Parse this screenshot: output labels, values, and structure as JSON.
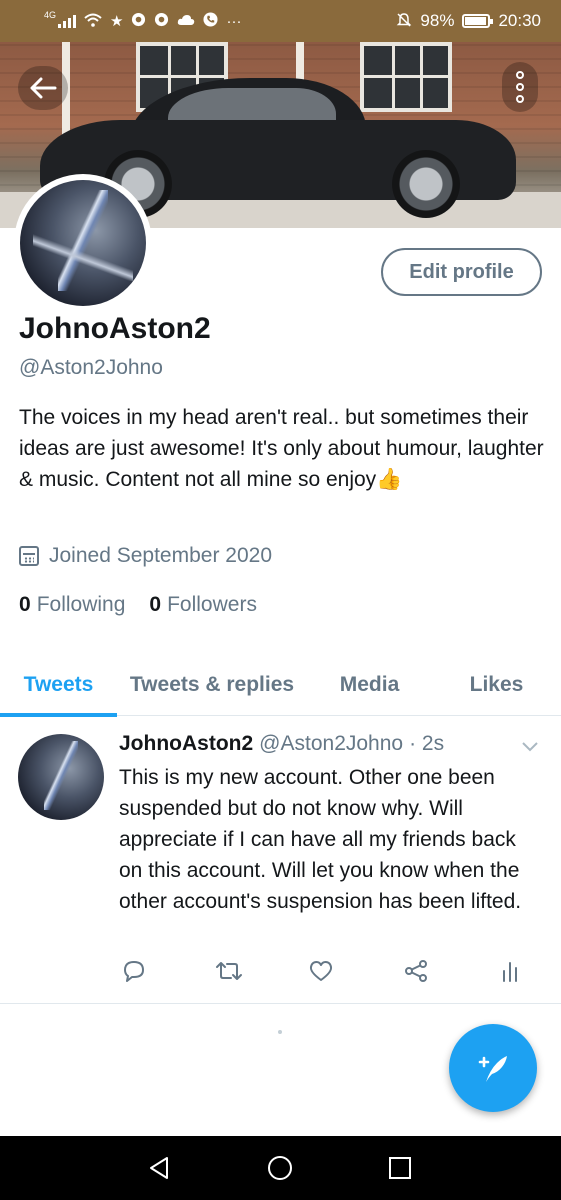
{
  "status_bar": {
    "network": "4G",
    "battery_percent": "98%",
    "time": "20:30",
    "more": "···",
    "icons": [
      "signal-icon",
      "wifi-icon",
      "star-icon",
      "chrome-icon",
      "chrome-icon",
      "cloud-icon",
      "phone-icon",
      "mute-bell-icon",
      "battery-icon"
    ]
  },
  "header": {
    "back_icon": "arrow-left-icon",
    "more_icon": "vertical-dots-icon"
  },
  "profile": {
    "name": "JohnoAston2",
    "handle": "@Aston2Johno",
    "bio": "The voices in my head aren't real.. but sometimes their ideas are just awesome! It's only about humour, laughter & music. Content not all mine so enjoy👍",
    "joined": "Joined September 2020",
    "edit_profile_label": "Edit profile",
    "following_count": "0",
    "following_label": "Following",
    "followers_count": "0",
    "followers_label": "Followers"
  },
  "tabs": [
    {
      "label": "Tweets",
      "active": true
    },
    {
      "label": "Tweets & replies",
      "active": false
    },
    {
      "label": "Media",
      "active": false
    },
    {
      "label": "Likes",
      "active": false
    }
  ],
  "tweet": {
    "author_name": "JohnoAston2",
    "author_handle": "@Aston2Johno",
    "time": "· 2s",
    "text": "This is my new account. Other one been suspended but do not know why. Will appreciate if I can have all my friends back on this account. Will let you know when the other account's suspension has been lifted.",
    "actions": [
      "reply-icon",
      "retweet-icon",
      "like-icon",
      "share-icon",
      "analytics-icon"
    ]
  },
  "fab": {
    "icon": "compose-tweet-icon"
  },
  "nav": {
    "buttons": [
      "back-triangle-icon",
      "home-circle-icon",
      "recents-square-icon"
    ]
  },
  "colors": {
    "accent": "#1da1f2",
    "secondary_text": "#657786",
    "primary_text": "#14171a",
    "status_bar": "#8a6a3c"
  }
}
